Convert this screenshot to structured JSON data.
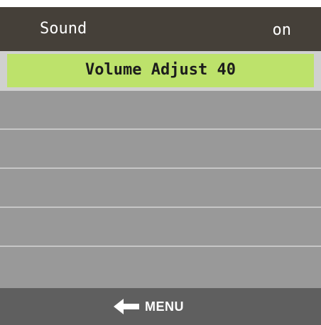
{
  "header": {
    "title": "Sound",
    "state": "on"
  },
  "menu": {
    "items": [
      {
        "label": "Volume Adjust 40",
        "selected": true
      },
      {
        "label": ""
      },
      {
        "label": ""
      },
      {
        "label": ""
      },
      {
        "label": ""
      },
      {
        "label": ""
      }
    ]
  },
  "footer": {
    "back_icon": "return-arrow-icon",
    "back_label": "MENU"
  },
  "colors": {
    "header_bg": "#454039",
    "menu_bg": "#999999",
    "selected_bg": "#bde26b",
    "footer_bg": "#5f5f5f"
  }
}
